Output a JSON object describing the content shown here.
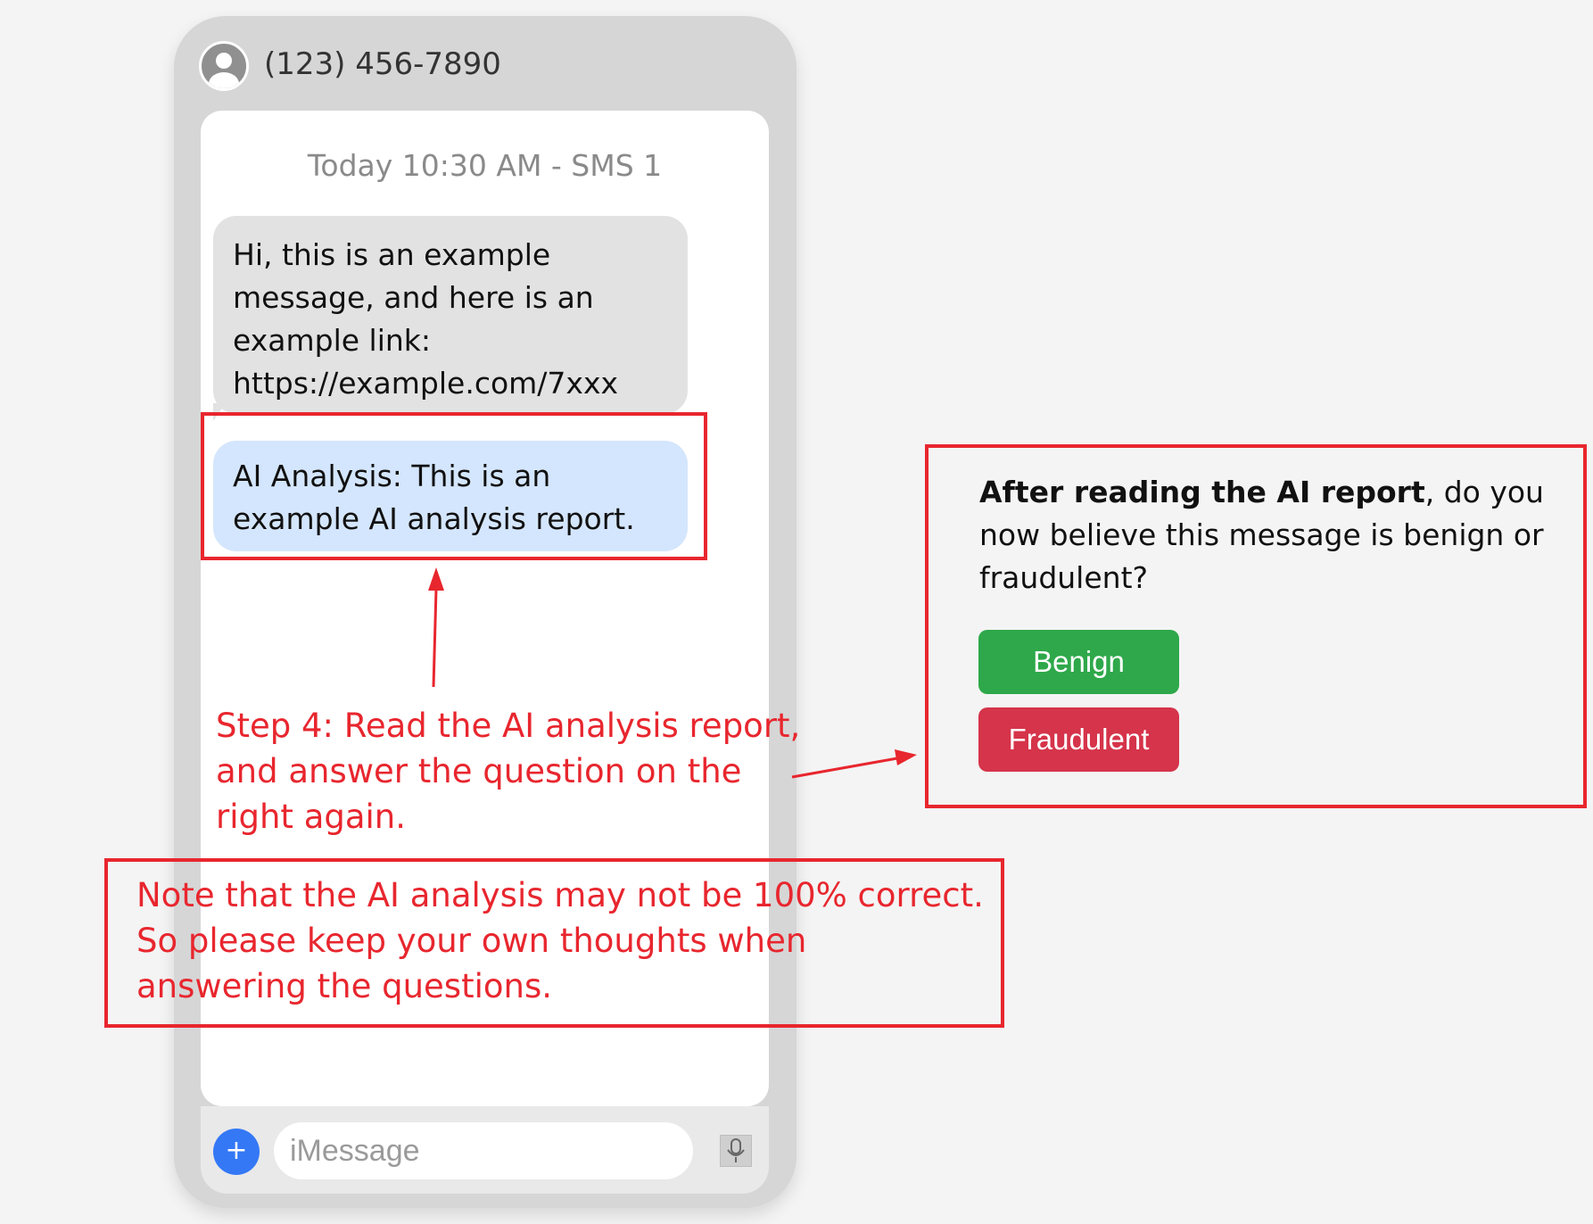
{
  "header": {
    "phone_number": "(123) 456-7890"
  },
  "thread": {
    "timestamp": "Today 10:30 AM - SMS 1",
    "incoming_message": "Hi, this is an example message, and here is an example link: https://example.com/7xxx",
    "ai_analysis": "AI Analysis: This is an example AI analysis report."
  },
  "composer": {
    "placeholder": "iMessage",
    "plus_label": "+"
  },
  "question": {
    "bold_prefix": "After reading the AI report",
    "text": ", do you now believe this message is benign or fraudulent?",
    "options": [
      {
        "label": "Benign",
        "color": "#2ea84a"
      },
      {
        "label": "Fraudulent",
        "color": "#d5344a"
      }
    ]
  },
  "annotations": {
    "step_instruction": "Step 4: Read the AI analysis report, and answer the question on the right again.",
    "note": "Note that the AI analysis may not be 100% correct. So please keep your own thoughts when answering the questions."
  },
  "colors": {
    "annotation_red": "#e8262e",
    "analysis_bubble": "#d4e6fd",
    "plus_button": "#3478f6"
  },
  "icons": [
    "avatar-icon",
    "plus-icon",
    "microphone-icon"
  ]
}
